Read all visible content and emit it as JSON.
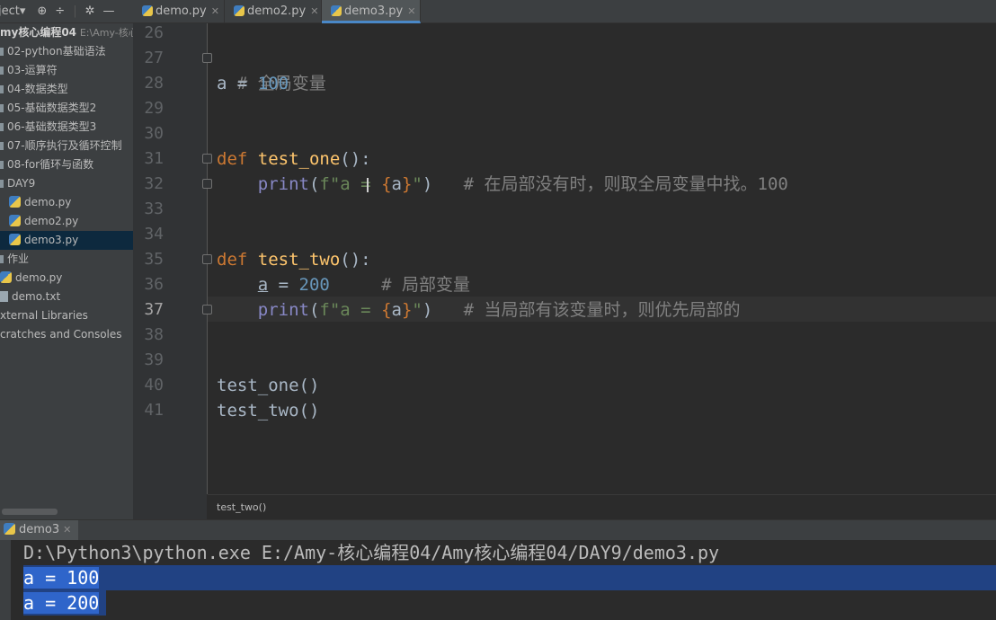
{
  "sidebar": {
    "toolbar": {
      "project_label": "ject▾",
      "icons": [
        "target-icon",
        "collapse-icon",
        "gear-icon",
        "minimize-icon"
      ]
    },
    "root": {
      "name": "my核心编程04",
      "path": "E:\\Amy-核心"
    },
    "items": [
      {
        "label": "02-python基础语法",
        "kind": "folder"
      },
      {
        "label": "03-运算符",
        "kind": "folder"
      },
      {
        "label": "04-数据类型",
        "kind": "folder"
      },
      {
        "label": "05-基础数据类型2",
        "kind": "folder"
      },
      {
        "label": "06-基础数据类型3",
        "kind": "folder"
      },
      {
        "label": "07-顺序执行及循环控制",
        "kind": "folder"
      },
      {
        "label": "08-for循环与函数",
        "kind": "folder"
      },
      {
        "label": "DAY9",
        "kind": "folder"
      },
      {
        "label": "demo.py",
        "kind": "python-file"
      },
      {
        "label": "demo2.py",
        "kind": "python-file"
      },
      {
        "label": "demo3.py",
        "kind": "python-file",
        "selected": true
      },
      {
        "label": "作业",
        "kind": "folder"
      },
      {
        "label": "demo.py",
        "kind": "python-file"
      },
      {
        "label": "demo.txt",
        "kind": "text-file"
      },
      {
        "label": "xternal Libraries",
        "kind": "library"
      },
      {
        "label": "cratches and Consoles",
        "kind": "scratch"
      }
    ]
  },
  "tabs": [
    {
      "label": "demo.py",
      "active": false
    },
    {
      "label": "demo2.py",
      "active": false
    },
    {
      "label": "demo3.py",
      "active": true
    }
  ],
  "editor": {
    "line_numbers": [
      "26",
      "27",
      "28",
      "29",
      "30",
      "31",
      "32",
      "33",
      "34",
      "35",
      "36",
      "37",
      "38",
      "39",
      "40",
      "41"
    ],
    "current_line": "37",
    "code": {
      "l27_comment": "# 全局变量",
      "l28_var": "a",
      "l28_eq": " = ",
      "l28_num": "100",
      "l31_def": "def",
      "l31_name": "test_one",
      "l31_rest": "():",
      "l32_indent": "    ",
      "l32_print": "print",
      "l32_open": "(",
      "l32_str1": "f\"a = ",
      "l32_lbrace": "{",
      "l32_a": "a",
      "l32_rbrace": "}",
      "l32_str2": "\"",
      "l32_close": ")",
      "l32_comment": "   # 在局部没有时，则取全局变量中找。100",
      "l35_def": "def",
      "l35_name": "test_two",
      "l35_rest": "():",
      "l36_indent": "    ",
      "l36_var": "a",
      "l36_eq": " = ",
      "l36_num": "200",
      "l36_comment": "     # 局部变量",
      "l37_indent": "    ",
      "l37_print": "print",
      "l37_open": "(",
      "l37_str1": "f\"a = ",
      "l37_lbrace": "{",
      "l37_a": "a",
      "l37_rbrace": "}",
      "l37_str2": "\"",
      "l37_close": ")",
      "l37_comment": "   # 当局部有该变量时，则优先局部的",
      "l40": "test_one()",
      "l41": "test_two()"
    },
    "breadcrumb": "test_two()"
  },
  "run": {
    "tab_label": "demo3",
    "lines": [
      "D:\\Python3\\python.exe E:/Amy-核心编程04/Amy核心编程04/DAY9/demo3.py",
      "a = 100",
      "a = 200"
    ]
  },
  "colors": {
    "keyword": "#cc7832",
    "function": "#ffc66d",
    "number": "#6897bb",
    "string": "#6a8759",
    "comment": "#808080",
    "builtin": "#8888c6",
    "selection": "#214283"
  }
}
